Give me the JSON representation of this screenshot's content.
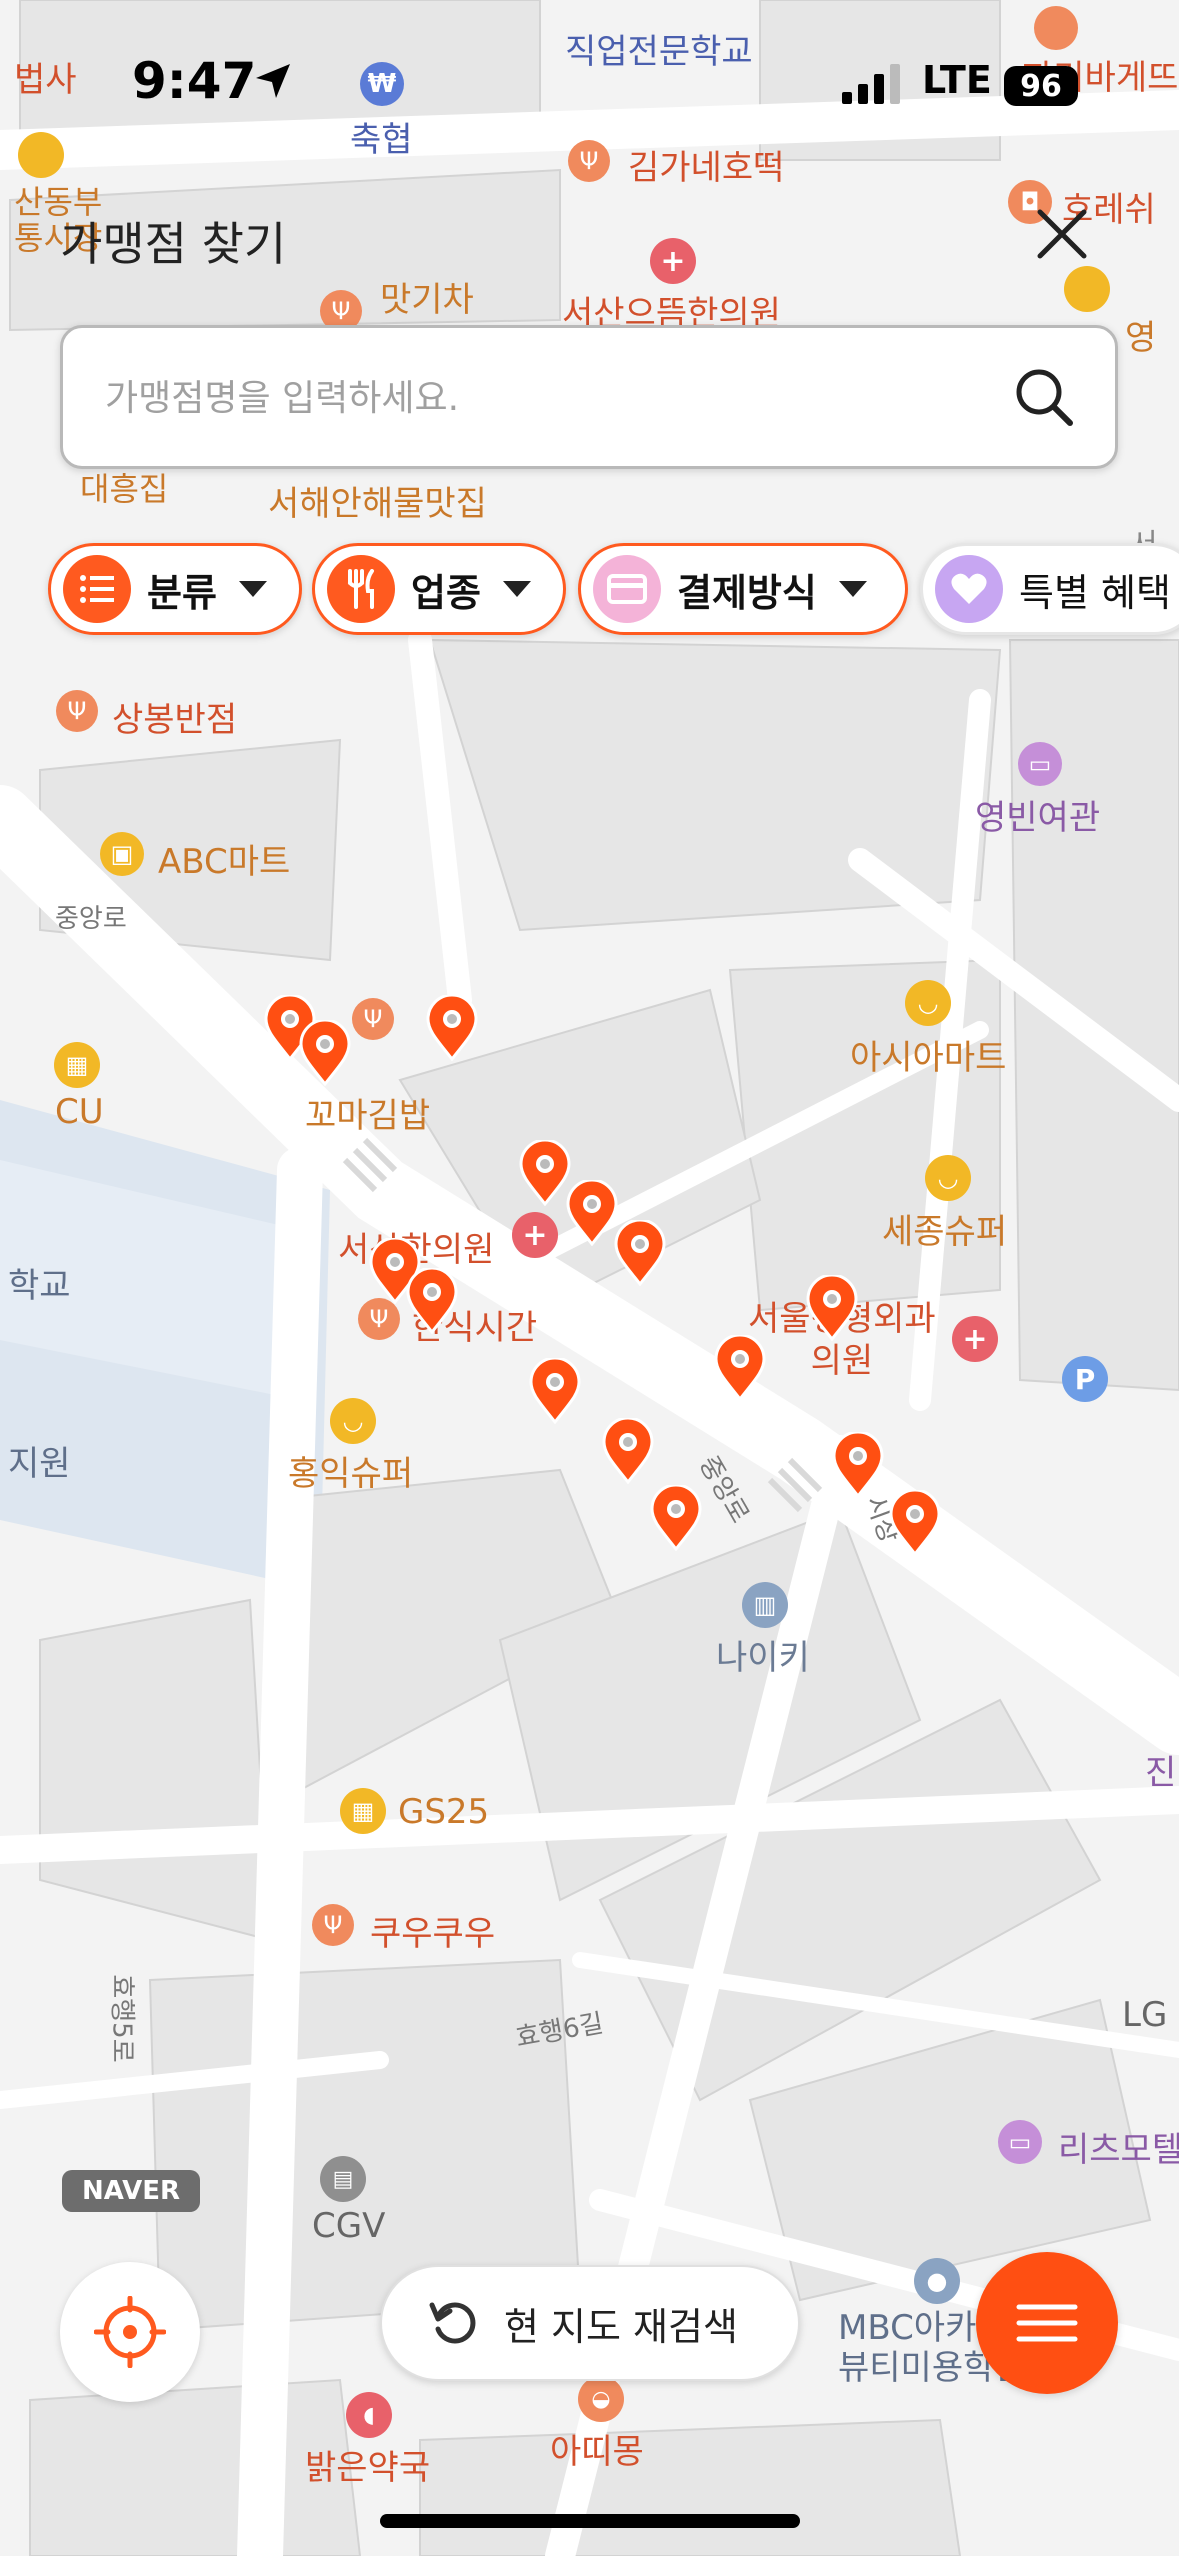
{
  "status_bar": {
    "time": "9:47",
    "network": "LTE",
    "battery": "96"
  },
  "header": {
    "title": "가맹점 찾기"
  },
  "search": {
    "placeholder": "가맹점명을 입력하세요."
  },
  "filters": [
    {
      "label": "분류",
      "icon": "list-icon"
    },
    {
      "label": "업종",
      "icon": "utensils-icon"
    },
    {
      "label": "결제방식",
      "icon": "card-icon"
    },
    {
      "label": "특별 혜택",
      "icon": "heart-icon"
    }
  ],
  "map": {
    "places": [
      {
        "name": "직업전문학교",
        "icon": "school"
      },
      {
        "name": "축협",
        "icon": "bank"
      },
      {
        "name": "김가네호떡",
        "icon": "restaurant"
      },
      {
        "name": "서산으뜸한의원",
        "icon": "hospital"
      },
      {
        "name": "맛기차",
        "icon": "restaurant"
      },
      {
        "name": "서해안해물맛집",
        "icon": "restaurant"
      },
      {
        "name": "대흥집",
        "icon": "restaurant"
      },
      {
        "name": "상봉반점",
        "icon": "restaurant"
      },
      {
        "name": "영빈여관",
        "icon": "lodging"
      },
      {
        "name": "ABC마트",
        "icon": "shopping"
      },
      {
        "name": "아시아마트",
        "icon": "mart"
      },
      {
        "name": "CU",
        "icon": "convenience"
      },
      {
        "name": "꼬마김밥",
        "icon": "restaurant"
      },
      {
        "name": "세종슈퍼",
        "icon": "mart"
      },
      {
        "name": "서산한의원",
        "icon": "hospital"
      },
      {
        "name": "한식시간",
        "icon": "restaurant"
      },
      {
        "name": "서울정형외과\n의원",
        "icon": "hospital"
      },
      {
        "name": "홍익슈퍼",
        "icon": "mart"
      },
      {
        "name": "나이키",
        "icon": "building"
      },
      {
        "name": "GS25",
        "icon": "convenience"
      },
      {
        "name": "쿠우쿠우",
        "icon": "restaurant"
      },
      {
        "name": "CGV",
        "icon": "cinema"
      },
      {
        "name": "리츠모텔",
        "icon": "lodging"
      },
      {
        "name": "MBC아카\n뷰티미용학원",
        "icon": "school"
      },
      {
        "name": "아띠몽",
        "icon": "restaurant"
      },
      {
        "name": "밝은약국",
        "icon": "pharmacy"
      },
      {
        "name": "파리바게뜨",
        "icon": "bakery"
      },
      {
        "name": "호레쉬",
        "icon": "cafe"
      },
      {
        "name": "산동부\n통시장",
        "icon": "market"
      },
      {
        "name": "법사",
        "icon": "none"
      },
      {
        "name": "영",
        "icon": "none"
      },
      {
        "name": "학교",
        "icon": "none"
      },
      {
        "name": "지원",
        "icon": "none"
      },
      {
        "name": "진",
        "icon": "none"
      },
      {
        "name": "LG",
        "icon": "none"
      },
      {
        "name": "서",
        "icon": "none"
      }
    ],
    "roads": [
      "중앙로",
      "중앙로",
      "효행5로",
      "효행6길",
      "시장"
    ],
    "brand": "NAVER"
  },
  "controls": {
    "locate_icon": "crosshair-icon",
    "reload_label": "현 지도 재검색",
    "menu_icon": "hamburger-icon"
  },
  "colors": {
    "accent": "#ff5a1f",
    "pin": "#ff4f12",
    "water": "#dde6f0"
  }
}
